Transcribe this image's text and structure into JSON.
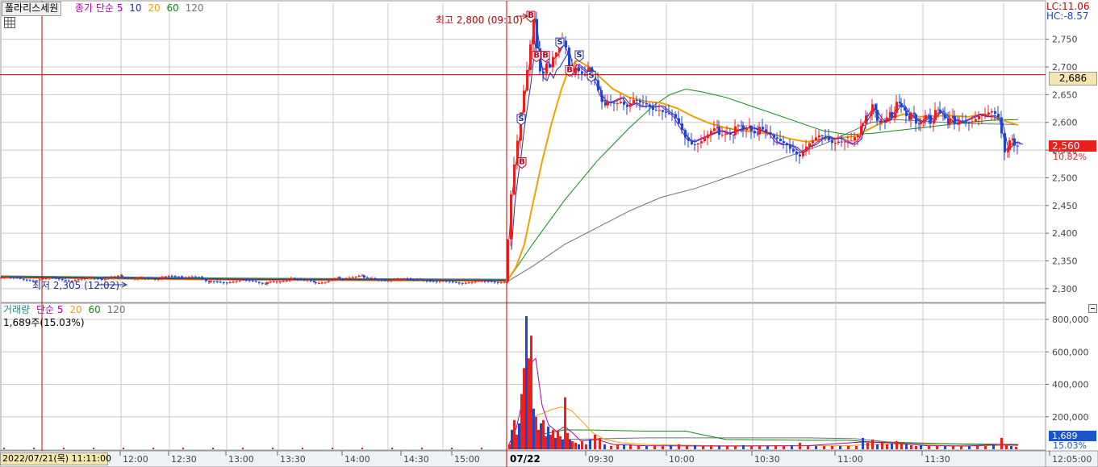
{
  "colors": {
    "up": "#e8211d",
    "down": "#1f47c9",
    "ma5": "#b100b1",
    "ma10": "#1c2fc4",
    "ma20": "#f0a000",
    "ma60": "#128a12",
    "ma120": "#707070",
    "crosshair": "#d00000",
    "grid": "#c8c8c8",
    "price_badge": "#e8211d",
    "cursor_badge": "#f5e6b0",
    "volume_badge": "#1a55c9"
  },
  "price_panel": {
    "stock_name": "폴라리스세원",
    "price_legend": [
      {
        "label": "종가 단순",
        "color": "#b100b1"
      },
      {
        "label": "5",
        "color": "#b100b1"
      },
      {
        "label": "10",
        "color": "#1c2fc4"
      },
      {
        "label": "20",
        "color": "#f0a000"
      },
      {
        "label": "60",
        "color": "#128a12"
      },
      {
        "label": "120",
        "color": "#707070"
      }
    ],
    "lc_label": "LC:11.06",
    "hc_label": "HC:-8.57",
    "high_annotation": "최고 2,800 (09:10)",
    "low_annotation": "최저 2,305 (12:02)",
    "cursor_price": "2,686",
    "current_price": "2,560",
    "current_change": "10.82%"
  },
  "volume_panel": {
    "legend": [
      {
        "label": "거래량",
        "color": "#1c8a8a"
      },
      {
        "label": "단순",
        "color": "#b100b1"
      },
      {
        "label": "5",
        "color": "#b100b1"
      },
      {
        "label": "20",
        "color": "#f0a000"
      },
      {
        "label": "60",
        "color": "#128a12"
      },
      {
        "label": "120",
        "color": "#707070"
      }
    ],
    "current_volume_text": "1,689주(15.03%)",
    "volume_badge": "1,689",
    "volume_pct": "15.03%"
  },
  "time_axis": {
    "cursor_label": "2022/07/21(목) 11:11:00",
    "day_label": "07/22",
    "ticks": [
      "12:00",
      "12:30",
      "13:00",
      "13:30",
      "14:00",
      "14:30",
      "15:00",
      "09:30",
      "10:00",
      "10:30",
      "11:00",
      "11:30",
      "12:05:00"
    ]
  },
  "chart_data": {
    "type": "candlestick",
    "title": "폴라리스세원",
    "y_ticks": [
      2750,
      2700,
      2650,
      2600,
      2550,
      2500,
      2450,
      2400,
      2350,
      2300
    ],
    "ylim": [
      2275,
      2815
    ],
    "high": {
      "value": 2800,
      "time": "09:10"
    },
    "low": {
      "value": 2305,
      "time": "12:02"
    },
    "crosshair_price": 2686,
    "last_price": 2560,
    "price_path": [
      [
        0,
        2320
      ],
      [
        20,
        2318
      ],
      [
        40,
        2316
      ],
      [
        60,
        2318
      ],
      [
        80,
        2316
      ],
      [
        100,
        2317
      ],
      [
        125,
        2318
      ],
      [
        150,
        2322
      ],
      [
        175,
        2318
      ],
      [
        200,
        2320
      ],
      [
        225,
        2322
      ],
      [
        250,
        2318
      ],
      [
        260,
        2312
      ],
      [
        300,
        2314
      ],
      [
        330,
        2310
      ],
      [
        360,
        2318
      ],
      [
        380,
        2318
      ],
      [
        390,
        2310
      ],
      [
        420,
        2320
      ],
      [
        450,
        2322
      ],
      [
        460,
        2318
      ],
      [
        480,
        2316
      ],
      [
        500,
        2316
      ],
      [
        520,
        2318
      ],
      [
        540,
        2312
      ],
      [
        560,
        2312
      ],
      [
        580,
        2312
      ],
      [
        600,
        2312
      ],
      [
        627,
        2314
      ],
      [
        628,
        2390
      ],
      [
        632,
        2470
      ],
      [
        636,
        2520
      ],
      [
        640,
        2560
      ],
      [
        644,
        2610
      ],
      [
        648,
        2650
      ],
      [
        652,
        2690
      ],
      [
        656,
        2740
      ],
      [
        660,
        2790
      ],
      [
        664,
        2740
      ],
      [
        668,
        2700
      ],
      [
        672,
        2695
      ],
      [
        676,
        2710
      ],
      [
        680,
        2700
      ],
      [
        684,
        2715
      ],
      [
        688,
        2720
      ],
      [
        692,
        2730
      ],
      [
        696,
        2740
      ],
      [
        700,
        2730
      ],
      [
        704,
        2700
      ],
      [
        708,
        2690
      ],
      [
        712,
        2705
      ],
      [
        716,
        2700
      ],
      [
        720,
        2695
      ],
      [
        724,
        2690
      ],
      [
        728,
        2700
      ],
      [
        732,
        2680
      ],
      [
        736,
        2670
      ],
      [
        740,
        2650
      ],
      [
        745,
        2640
      ],
      [
        752,
        2635
      ],
      [
        760,
        2640
      ],
      [
        768,
        2645
      ],
      [
        776,
        2630
      ],
      [
        784,
        2635
      ],
      [
        792,
        2628
      ],
      [
        800,
        2630
      ],
      [
        808,
        2628
      ],
      [
        816,
        2630
      ],
      [
        824,
        2620
      ],
      [
        832,
        2610
      ],
      [
        840,
        2590
      ],
      [
        848,
        2570
      ],
      [
        856,
        2565
      ],
      [
        864,
        2570
      ],
      [
        872,
        2575
      ],
      [
        880,
        2580
      ],
      [
        890,
        2585
      ],
      [
        900,
        2580
      ],
      [
        910,
        2585
      ],
      [
        920,
        2590
      ],
      [
        930,
        2590
      ],
      [
        940,
        2585
      ],
      [
        950,
        2580
      ],
      [
        958,
        2565
      ],
      [
        966,
        2560
      ],
      [
        974,
        2560
      ],
      [
        982,
        2555
      ],
      [
        990,
        2545
      ],
      [
        998,
        2555
      ],
      [
        1006,
        2560
      ],
      [
        1014,
        2570
      ],
      [
        1022,
        2575
      ],
      [
        1030,
        2570
      ],
      [
        1038,
        2572
      ],
      [
        1046,
        2565
      ],
      [
        1054,
        2560
      ],
      [
        1062,
        2570
      ],
      [
        1068,
        2600
      ],
      [
        1074,
        2615
      ],
      [
        1080,
        2625
      ],
      [
        1086,
        2610
      ],
      [
        1092,
        2600
      ],
      [
        1098,
        2605
      ],
      [
        1104,
        2615
      ],
      [
        1110,
        2630
      ],
      [
        1116,
        2630
      ],
      [
        1122,
        2615
      ],
      [
        1128,
        2610
      ],
      [
        1134,
        2605
      ],
      [
        1140,
        2600
      ],
      [
        1146,
        2610
      ],
      [
        1152,
        2605
      ],
      [
        1158,
        2615
      ],
      [
        1164,
        2620
      ],
      [
        1170,
        2610
      ],
      [
        1176,
        2600
      ],
      [
        1182,
        2605
      ],
      [
        1188,
        2600
      ],
      [
        1196,
        2605
      ],
      [
        1204,
        2610
      ],
      [
        1212,
        2615
      ],
      [
        1220,
        2610
      ],
      [
        1228,
        2612
      ],
      [
        1236,
        2605
      ],
      [
        1240,
        2580
      ],
      [
        1244,
        2550
      ],
      [
        1250,
        2560
      ],
      [
        1256,
        2565
      ],
      [
        1262,
        2560
      ]
    ],
    "ma20_path": [
      [
        628,
        2312
      ],
      [
        640,
        2340
      ],
      [
        650,
        2380
      ],
      [
        660,
        2450
      ],
      [
        672,
        2530
      ],
      [
        684,
        2600
      ],
      [
        696,
        2660
      ],
      [
        706,
        2700
      ],
      [
        716,
        2712
      ],
      [
        730,
        2700
      ],
      [
        745,
        2680
      ],
      [
        760,
        2660
      ],
      [
        780,
        2645
      ],
      [
        800,
        2638
      ],
      [
        820,
        2635
      ],
      [
        840,
        2625
      ],
      [
        860,
        2610
      ],
      [
        880,
        2598
      ],
      [
        900,
        2590
      ],
      [
        920,
        2585
      ],
      [
        940,
        2582
      ],
      [
        960,
        2578
      ],
      [
        980,
        2570
      ],
      [
        1000,
        2565
      ],
      [
        1020,
        2570
      ],
      [
        1040,
        2572
      ],
      [
        1060,
        2575
      ],
      [
        1080,
        2590
      ],
      [
        1100,
        2605
      ],
      [
        1120,
        2615
      ],
      [
        1140,
        2610
      ],
      [
        1160,
        2612
      ],
      [
        1180,
        2612
      ],
      [
        1200,
        2610
      ],
      [
        1220,
        2615
      ],
      [
        1240,
        2605
      ],
      [
        1262,
        2595
      ]
    ],
    "ma60_path": [
      [
        628,
        2312
      ],
      [
        660,
        2380
      ],
      [
        700,
        2460
      ],
      [
        740,
        2530
      ],
      [
        780,
        2590
      ],
      [
        810,
        2630
      ],
      [
        830,
        2650
      ],
      [
        850,
        2660
      ],
      [
        870,
        2655
      ],
      [
        900,
        2645
      ],
      [
        930,
        2630
      ],
      [
        960,
        2615
      ],
      [
        990,
        2600
      ],
      [
        1020,
        2585
      ],
      [
        1050,
        2578
      ],
      [
        1080,
        2580
      ],
      [
        1110,
        2585
      ],
      [
        1140,
        2590
      ],
      [
        1170,
        2595
      ],
      [
        1200,
        2600
      ],
      [
        1230,
        2604
      ],
      [
        1262,
        2605
      ]
    ],
    "ma120_path": [
      [
        628,
        2312
      ],
      [
        660,
        2340
      ],
      [
        700,
        2380
      ],
      [
        740,
        2410
      ],
      [
        780,
        2440
      ],
      [
        820,
        2465
      ],
      [
        860,
        2480
      ],
      [
        900,
        2500
      ],
      [
        940,
        2520
      ],
      [
        980,
        2540
      ],
      [
        1020,
        2560
      ],
      [
        1050,
        2580
      ],
      [
        1080,
        2600
      ],
      [
        1110,
        2605
      ],
      [
        1140,
        2603
      ],
      [
        1170,
        2600
      ],
      [
        1200,
        2598
      ],
      [
        1230,
        2597
      ],
      [
        1262,
        2596
      ]
    ],
    "volume_ticks": [
      800000,
      600000,
      400000,
      200000
    ],
    "volume_ylim": [
      0,
      900000
    ],
    "volume_bars": [
      [
        630,
        30000
      ],
      [
        633,
        120000
      ],
      [
        636,
        180000
      ],
      [
        639,
        90000
      ],
      [
        642,
        160000
      ],
      [
        645,
        340000
      ],
      [
        648,
        500000
      ],
      [
        651,
        820000
      ],
      [
        654,
        560000
      ],
      [
        657,
        700000
      ],
      [
        660,
        250000
      ],
      [
        663,
        200000
      ],
      [
        666,
        120000
      ],
      [
        669,
        160000
      ],
      [
        672,
        180000
      ],
      [
        675,
        80000
      ],
      [
        678,
        140000
      ],
      [
        681,
        90000
      ],
      [
        684,
        120000
      ],
      [
        687,
        70000
      ],
      [
        690,
        110000
      ],
      [
        693,
        80000
      ],
      [
        696,
        60000
      ],
      [
        699,
        320000
      ],
      [
        702,
        100000
      ],
      [
        705,
        60000
      ],
      [
        708,
        50000
      ],
      [
        712,
        40000
      ],
      [
        716,
        30000
      ],
      [
        720,
        50000
      ],
      [
        725,
        30000
      ],
      [
        730,
        60000
      ],
      [
        736,
        90000
      ],
      [
        742,
        70000
      ],
      [
        748,
        30000
      ],
      [
        756,
        20000
      ],
      [
        764,
        30000
      ],
      [
        772,
        25000
      ],
      [
        780,
        30000
      ],
      [
        790,
        25000
      ],
      [
        800,
        20000
      ],
      [
        810,
        25000
      ],
      [
        820,
        20000
      ],
      [
        830,
        25000
      ],
      [
        840,
        30000
      ],
      [
        850,
        20000
      ],
      [
        860,
        25000
      ],
      [
        870,
        20000
      ],
      [
        880,
        25000
      ],
      [
        890,
        20000
      ],
      [
        900,
        20000
      ],
      [
        910,
        20000
      ],
      [
        920,
        25000
      ],
      [
        930,
        20000
      ],
      [
        940,
        20000
      ],
      [
        950,
        20000
      ],
      [
        960,
        25000
      ],
      [
        970,
        20000
      ],
      [
        980,
        25000
      ],
      [
        990,
        40000
      ],
      [
        1000,
        20000
      ],
      [
        1010,
        20000
      ],
      [
        1020,
        20000
      ],
      [
        1030,
        20000
      ],
      [
        1040,
        20000
      ],
      [
        1050,
        20000
      ],
      [
        1060,
        20000
      ],
      [
        1068,
        70000
      ],
      [
        1074,
        40000
      ],
      [
        1080,
        60000
      ],
      [
        1086,
        30000
      ],
      [
        1092,
        40000
      ],
      [
        1098,
        30000
      ],
      [
        1104,
        35000
      ],
      [
        1110,
        50000
      ],
      [
        1116,
        40000
      ],
      [
        1122,
        30000
      ],
      [
        1128,
        25000
      ],
      [
        1134,
        20000
      ],
      [
        1140,
        25000
      ],
      [
        1150,
        20000
      ],
      [
        1160,
        20000
      ],
      [
        1170,
        20000
      ],
      [
        1180,
        20000
      ],
      [
        1190,
        20000
      ],
      [
        1200,
        20000
      ],
      [
        1210,
        20000
      ],
      [
        1220,
        20000
      ],
      [
        1230,
        25000
      ],
      [
        1240,
        70000
      ],
      [
        1246,
        30000
      ],
      [
        1252,
        20000
      ],
      [
        1258,
        15000
      ]
    ],
    "volume_ma20_path": [
      [
        630,
        10000
      ],
      [
        645,
        80000
      ],
      [
        660,
        200000
      ],
      [
        672,
        220000
      ],
      [
        684,
        245000
      ],
      [
        696,
        260000
      ],
      [
        708,
        240000
      ],
      [
        720,
        180000
      ],
      [
        735,
        100000
      ],
      [
        750,
        60000
      ],
      [
        770,
        40000
      ],
      [
        800,
        30000
      ],
      [
        850,
        25000
      ],
      [
        900,
        22000
      ],
      [
        950,
        22000
      ],
      [
        1000,
        22000
      ],
      [
        1050,
        22000
      ],
      [
        1080,
        30000
      ],
      [
        1110,
        32000
      ],
      [
        1140,
        28000
      ],
      [
        1180,
        22000
      ],
      [
        1220,
        22000
      ],
      [
        1262,
        24000
      ]
    ],
    "volume_ma5_path": [
      [
        630,
        20000
      ],
      [
        640,
        130000
      ],
      [
        650,
        350000
      ],
      [
        656,
        520000
      ],
      [
        664,
        560000
      ],
      [
        672,
        270000
      ],
      [
        680,
        150000
      ],
      [
        690,
        110000
      ],
      [
        700,
        140000
      ],
      [
        710,
        100000
      ],
      [
        720,
        50000
      ],
      [
        740,
        60000
      ],
      [
        760,
        30000
      ],
      [
        800,
        22000
      ],
      [
        900,
        20000
      ],
      [
        1000,
        22000
      ],
      [
        1070,
        45000
      ],
      [
        1110,
        38000
      ],
      [
        1150,
        22000
      ],
      [
        1200,
        20000
      ],
      [
        1240,
        30000
      ],
      [
        1262,
        25000
      ]
    ],
    "volume_ma60_path": [
      [
        630,
        10000
      ],
      [
        660,
        80000
      ],
      [
        700,
        120000
      ],
      [
        740,
        118000
      ],
      [
        800,
        112000
      ],
      [
        850,
        112000
      ],
      [
        870,
        90000
      ],
      [
        900,
        60000
      ],
      [
        1000,
        55000
      ],
      [
        1050,
        55000
      ],
      [
        1080,
        45000
      ],
      [
        1150,
        35000
      ],
      [
        1262,
        30000
      ]
    ],
    "volume_ma120_path": [
      [
        630,
        5000
      ],
      [
        700,
        60000
      ],
      [
        800,
        70000
      ],
      [
        900,
        70000
      ],
      [
        1000,
        70000
      ],
      [
        1060,
        65000
      ],
      [
        1100,
        45000
      ],
      [
        1200,
        30000
      ],
      [
        1262,
        28000
      ]
    ],
    "markers": [
      {
        "x": 658,
        "price": 2790,
        "label": "B",
        "kind": "buy"
      },
      {
        "x": 665,
        "price": 2718,
        "label": "B",
        "kind": "buy"
      },
      {
        "x": 676,
        "price": 2718,
        "label": "B",
        "kind": "buy"
      },
      {
        "x": 706,
        "price": 2692,
        "label": "B",
        "kind": "buy"
      },
      {
        "x": 647,
        "price": 2526,
        "label": "B",
        "kind": "buy"
      },
      {
        "x": 646,
        "price": 2604,
        "label": "S",
        "kind": "sell"
      },
      {
        "x": 694,
        "price": 2742,
        "label": "S",
        "kind": "sell"
      },
      {
        "x": 718,
        "price": 2719,
        "label": "S",
        "kind": "sell"
      },
      {
        "x": 733,
        "price": 2682,
        "label": "S",
        "kind": "sell"
      }
    ]
  }
}
